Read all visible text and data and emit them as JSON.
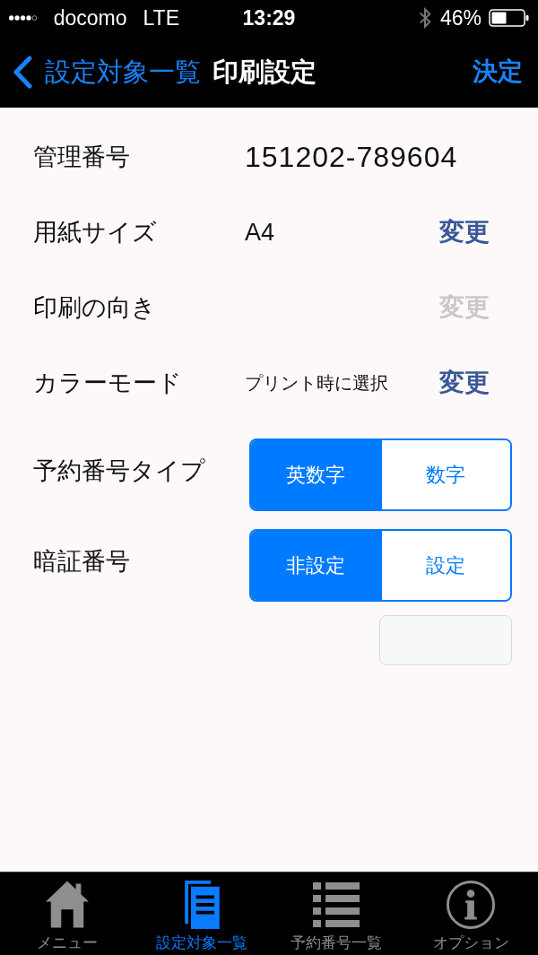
{
  "status_bar": {
    "carrier": "docomo",
    "network": "LTE",
    "time": "13:29",
    "battery": "46%"
  },
  "nav_bar": {
    "back": "設定対象一覧",
    "title": "印刷設定",
    "action": "決定"
  },
  "settings": [
    {
      "kind": "value",
      "label": "管理番号",
      "value": "151202-789604"
    },
    {
      "kind": "change",
      "label": "用紙サイズ",
      "value": "A4",
      "button": {
        "label": "変更",
        "disabled": false
      }
    },
    {
      "kind": "change",
      "label": "印刷の向き",
      "button": {
        "label": "変更",
        "disabled": true
      }
    },
    {
      "kind": "change",
      "label": "カラーモード",
      "value": "プリント時に選択",
      "button": {
        "label": "変更",
        "disabled": false
      }
    },
    {
      "kind": "segment",
      "label": "予約番号タイプ",
      "options": [
        {
          "label": "英数字",
          "selected": true
        },
        {
          "label": "数字",
          "selected": false
        }
      ]
    },
    {
      "kind": "segment",
      "label": "暗証番号",
      "options": [
        {
          "label": "非設定",
          "selected": true
        },
        {
          "label": "設定",
          "selected": false
        }
      ]
    },
    {
      "kind": "field"
    }
  ],
  "tabs": [
    {
      "label": "メニュー",
      "selected": false
    },
    {
      "label": "設定対象一覧",
      "selected": true
    },
    {
      "label": "予約番号一覧",
      "selected": false
    },
    {
      "label": "オプション",
      "selected": false
    }
  ]
}
